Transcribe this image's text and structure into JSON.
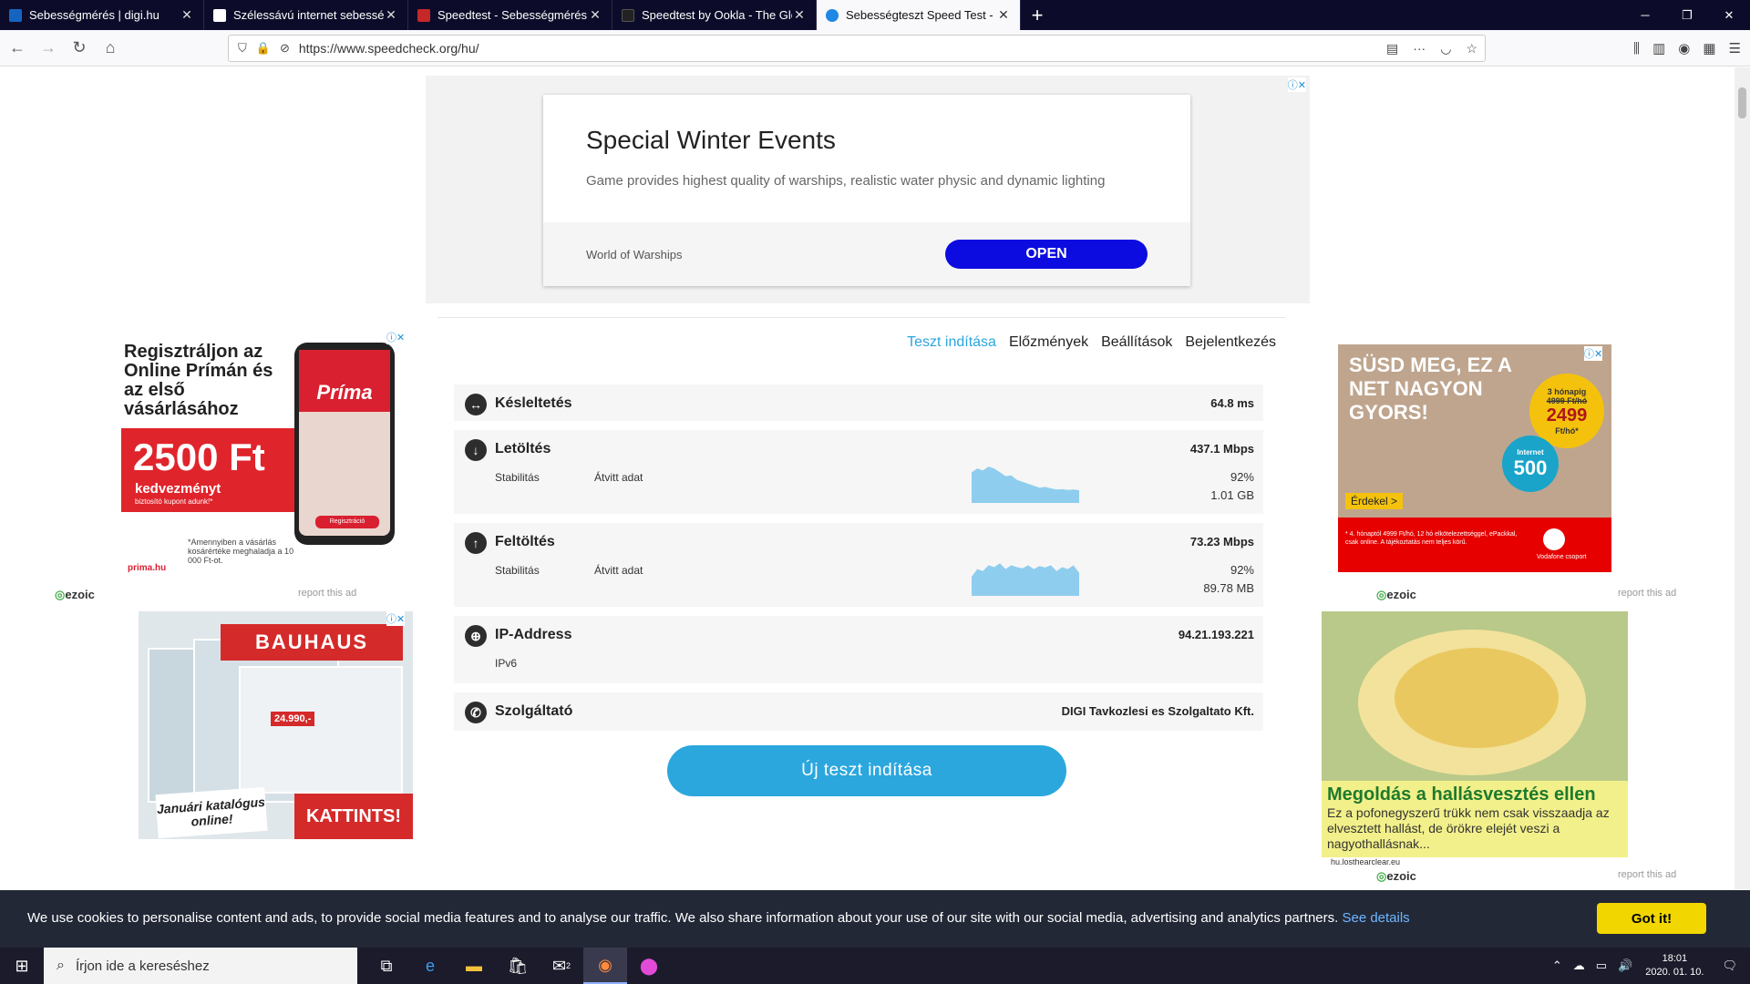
{
  "browser": {
    "tabs": [
      {
        "title": "Sebességmérés | digi.hu",
        "favicon_color": "#1565c0",
        "active": false
      },
      {
        "title": "Szélessávú internet sebességteszt",
        "favicon_color": "#ffffff",
        "active": false
      },
      {
        "title": "Speedtest - Sebességmérés - speed",
        "favicon_color": "#c62828",
        "active": false
      },
      {
        "title": "Speedtest by Ookla - The Global",
        "favicon_color": "#222222",
        "active": false
      },
      {
        "title": "Sebességteszt Speed Test - Speedcheck",
        "favicon_color": "#1e88e5",
        "active": true
      }
    ],
    "new_tab_label": "+",
    "url": "https://www.speedcheck.org/hu/",
    "window_controls": {
      "minimize": "─",
      "restore": "❐",
      "close": "✕"
    }
  },
  "top_ad": {
    "title": "Special Winter Events",
    "description": "Game provides highest quality of warships, realistic water physic and dynamic lighting",
    "brand": "World of Warships",
    "cta": "OPEN"
  },
  "nav": {
    "items": [
      "Teszt indítása",
      "Előzmények",
      "Beállítások",
      "Bejelentkezés"
    ],
    "active_index": 0
  },
  "results": {
    "latency": {
      "label": "Késleltetés",
      "value": "64.8 ms",
      "icon": "latency-icon"
    },
    "download": {
      "label": "Letöltés",
      "value": "437.1 Mbps",
      "stability_label": "Stabilitás",
      "transferred_label": "Átvitt adat",
      "stability": "92%",
      "transferred": "1.01 GB",
      "icon": "download-icon",
      "graph": [
        0.8,
        0.9,
        0.85,
        0.95,
        0.9,
        0.8,
        0.7,
        0.72,
        0.6,
        0.55,
        0.5,
        0.45,
        0.4,
        0.42,
        0.38,
        0.35,
        0.36,
        0.34,
        0.35,
        0.33
      ]
    },
    "upload": {
      "label": "Feltöltés",
      "value": "73.23 Mbps",
      "stability_label": "Stabilitás",
      "transferred_label": "Átvitt adat",
      "stability": "92%",
      "transferred": "89.78 MB",
      "icon": "upload-icon",
      "graph": [
        0.5,
        0.7,
        0.65,
        0.8,
        0.75,
        0.85,
        0.7,
        0.8,
        0.75,
        0.72,
        0.8,
        0.7,
        0.78,
        0.74,
        0.8,
        0.65,
        0.75,
        0.7,
        0.8,
        0.6
      ]
    },
    "ip": {
      "label": "IP-Address",
      "value": "94.21.193.221",
      "version": "IPv6",
      "icon": "globe-icon"
    },
    "provider": {
      "label": "Szolgáltató",
      "value": "DIGI Tavkozlesi es Szolgaltato Kft.",
      "icon": "phone-icon"
    },
    "graph_color": "#8fcdee"
  },
  "new_test_button": "Új teszt indítása",
  "side_ads": {
    "prima": {
      "headline": "Regisztráljon az Online Prímán és az első vásárlásához",
      "amount": "2500 Ft",
      "discount": "kedvezményt",
      "coupon": "biztosító kupont adunk!*",
      "logo": "Príma",
      "register": "Regisztráció",
      "footnote": "*Amennyiben a vásárlás kosárértéke meghaladja a 10 000 Ft-ot.",
      "site": "prima.hu"
    },
    "bauhaus": {
      "brand": "BAUHAUS",
      "price": "24.990,-",
      "catalog": "Januári katalógus online!",
      "cta": "KATTINTS!"
    },
    "vodafone": {
      "headline": "SÜSD MEG, EZ A NET NAGYON GYORS!",
      "months": "3 hónapig",
      "old_price": "4999 Ft/hó",
      "price": "2499",
      "price_unit": "Ft/hó*",
      "internet_label": "Internet",
      "speed": "500",
      "cta": "Érdekel >",
      "footnote": "* 4. hónaptól 4999 Ft/hó, 12 hó elkötelezettséggel, ePackkal, csak online. A tájékoztatás nem teljes körű.",
      "group": "Vodafone csoport"
    },
    "fruit": {
      "title": "Megoldás a hallásvesztés ellen",
      "text": "Ez a pofonegyszerű trükk nem csak visszaadja az elvesztett hallást, de örökre elejét veszi a nagyothallásnak...",
      "source": "hu.losthearclear.eu"
    },
    "ezoic_label": "ezoic",
    "report_label": "report this ad"
  },
  "cookie": {
    "message": "We use cookies to personalise content and ads, to provide social media features and to analyse our traffic. We also share information about your use of our site with our social media, advertising and analytics partners.",
    "link": "See details",
    "button": "Got it!"
  },
  "taskbar": {
    "search_placeholder": "Írjon ide a kereséshez",
    "time": "18:01",
    "date": "2020. 01. 10.",
    "mail_badge": "2"
  }
}
